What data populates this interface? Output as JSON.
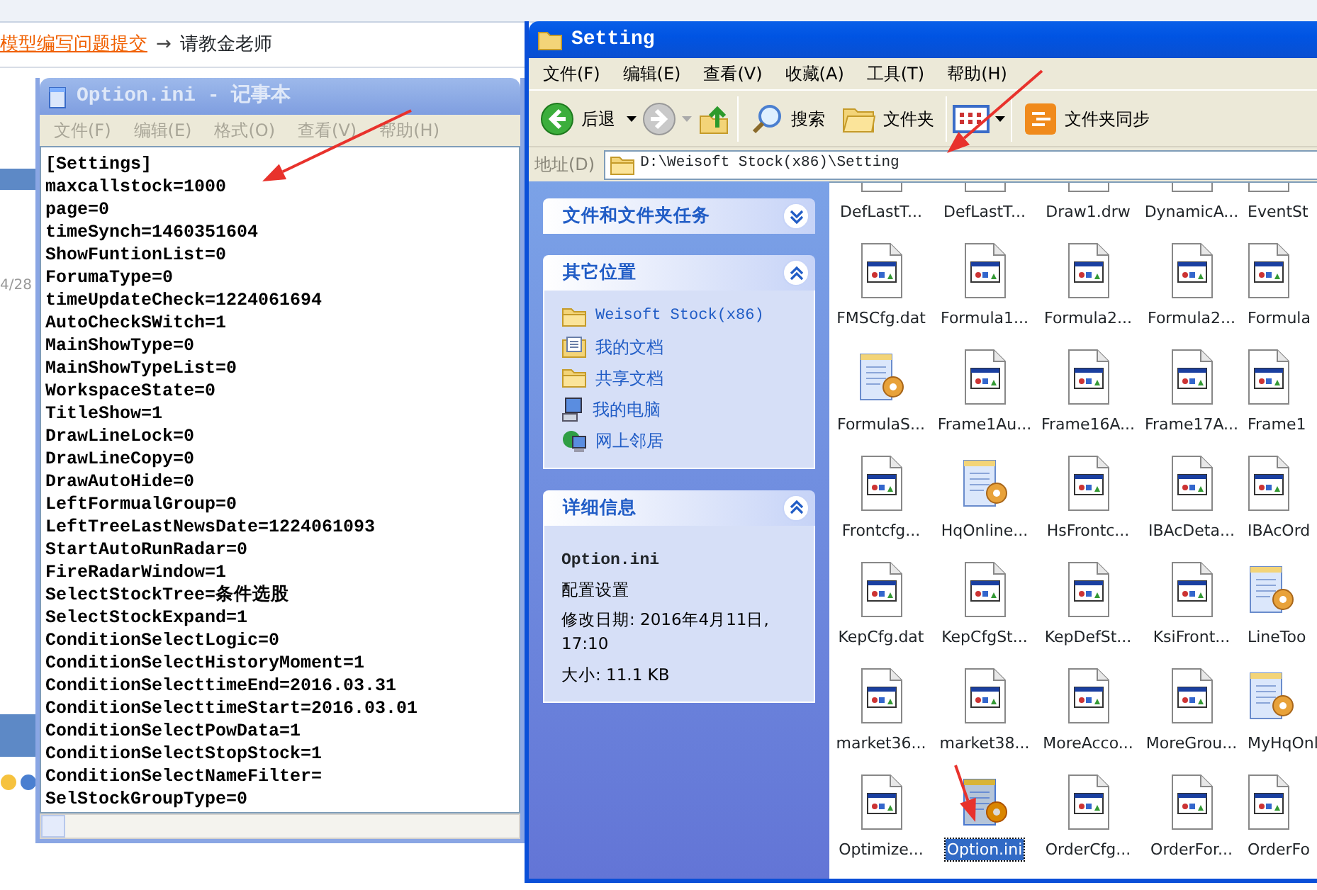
{
  "background_page": {
    "link": "模型编写问题提交",
    "arrow": "→",
    "text": "请教金老师",
    "date": "4/28"
  },
  "notepad": {
    "title": "Option.ini - 记事本",
    "active": false,
    "menu": [
      "文件(F)",
      "编辑(E)",
      "格式(O)",
      "查看(V)",
      "帮助(H)"
    ],
    "lines": [
      "[Settings]",
      "maxcallstock=1000",
      "page=0",
      "timeSynch=1460351604",
      "ShowFuntionList=0",
      "ForumaType=0",
      "timeUpdateCheck=1224061694",
      "AutoCheckSWitch=1",
      "MainShowType=0",
      "MainShowTypeList=0",
      "WorkspaceState=0",
      "TitleShow=1",
      "DrawLineLock=0",
      "DrawLineCopy=0",
      "DrawAutoHide=0",
      "LeftFormualGroup=0",
      "LeftTreeLastNewsDate=1224061093",
      "StartAutoRunRadar=0",
      "FireRadarWindow=1",
      "SelectStockTree=条件选股",
      "SelectStockExpand=1",
      "ConditionSelectLogic=0",
      "ConditionSelectHistoryMoment=1",
      "ConditionSelecttimeEnd=2016.03.31",
      "ConditionSelecttimeStart=2016.03.01",
      "ConditionSelectPowData=1",
      "ConditionSelectStopStock=1",
      "ConditionSelectNameFilter=",
      "SelStockGroupType=0"
    ]
  },
  "explorer": {
    "title": "Setting",
    "active": true,
    "menu": [
      "文件(F)",
      "编辑(E)",
      "查看(V)",
      "收藏(A)",
      "工具(T)",
      "帮助(H)"
    ],
    "toolbar": {
      "back": "后退",
      "search": "搜索",
      "folders": "文件夹",
      "sync": "文件夹同步"
    },
    "address": {
      "label": "地址(D)",
      "path": "D:\\Weisoft Stock(x86)\\Setting"
    },
    "panels": [
      {
        "title": "文件和文件夹任务",
        "expanded": false
      },
      {
        "title": "其它位置",
        "expanded": true,
        "items": [
          {
            "label": "Weisoft Stock(x86)",
            "kind": "folder"
          },
          {
            "label": "我的文档",
            "kind": "documents"
          },
          {
            "label": "共享文档",
            "kind": "folder"
          },
          {
            "label": "我的电脑",
            "kind": "computer"
          },
          {
            "label": "网上邻居",
            "kind": "network"
          }
        ]
      },
      {
        "title": "详细信息",
        "expanded": true,
        "details": {
          "name": "Option.ini",
          "type": "配置设置",
          "modified": "修改日期: 2016年4月11日, 17:10",
          "size": "大小: 11.1 KB"
        }
      }
    ],
    "files": [
      {
        "name": "DefLastT...",
        "kind": "dat",
        "selected": false
      },
      {
        "name": "DefLastT...",
        "kind": "dat",
        "selected": false
      },
      {
        "name": "Draw1.drw",
        "kind": "dat",
        "selected": false
      },
      {
        "name": "DynamicA...",
        "kind": "dat",
        "selected": false
      },
      {
        "name": "EventSt",
        "kind": "dat",
        "selected": false
      },
      {
        "name": "FMSCfg.dat",
        "kind": "dat",
        "selected": false
      },
      {
        "name": "Formula1...",
        "kind": "dat",
        "selected": false
      },
      {
        "name": "Formula2...",
        "kind": "dat",
        "selected": false
      },
      {
        "name": "Formula2...",
        "kind": "dat",
        "selected": false
      },
      {
        "name": "Formula",
        "kind": "dat",
        "selected": false
      },
      {
        "name": "FormulaS...",
        "kind": "ini",
        "selected": false
      },
      {
        "name": "Frame1Au...",
        "kind": "dat",
        "selected": false
      },
      {
        "name": "Frame16A...",
        "kind": "dat",
        "selected": false
      },
      {
        "name": "Frame17A...",
        "kind": "dat",
        "selected": false
      },
      {
        "name": "Frame1",
        "kind": "dat",
        "selected": false
      },
      {
        "name": "Frontcfg...",
        "kind": "dat",
        "selected": false
      },
      {
        "name": "HqOnline...",
        "kind": "ini",
        "selected": false
      },
      {
        "name": "HsFrontc...",
        "kind": "dat",
        "selected": false
      },
      {
        "name": "IBAcDeta...",
        "kind": "dat",
        "selected": false
      },
      {
        "name": "IBAcOrd",
        "kind": "dat",
        "selected": false
      },
      {
        "name": "KepCfg.dat",
        "kind": "dat",
        "selected": false
      },
      {
        "name": "KepCfgSt...",
        "kind": "dat",
        "selected": false
      },
      {
        "name": "KepDefSt...",
        "kind": "dat",
        "selected": false
      },
      {
        "name": "KsiFront...",
        "kind": "dat",
        "selected": false
      },
      {
        "name": "LineToo",
        "kind": "ini",
        "selected": false
      },
      {
        "name": "market36...",
        "kind": "dat",
        "selected": false
      },
      {
        "name": "market38...",
        "kind": "dat",
        "selected": false
      },
      {
        "name": "MoreAcco...",
        "kind": "dat",
        "selected": false
      },
      {
        "name": "MoreGrou...",
        "kind": "dat",
        "selected": false
      },
      {
        "name": "MyHqOnl",
        "kind": "ini",
        "selected": false
      },
      {
        "name": "Optimize...",
        "kind": "dat",
        "selected": false
      },
      {
        "name": "Option.ini",
        "kind": "ini",
        "selected": true
      },
      {
        "name": "OrderCfg...",
        "kind": "dat",
        "selected": false
      },
      {
        "name": "OrderFor...",
        "kind": "dat",
        "selected": false
      },
      {
        "name": "OrderFo",
        "kind": "dat",
        "selected": false
      }
    ]
  }
}
